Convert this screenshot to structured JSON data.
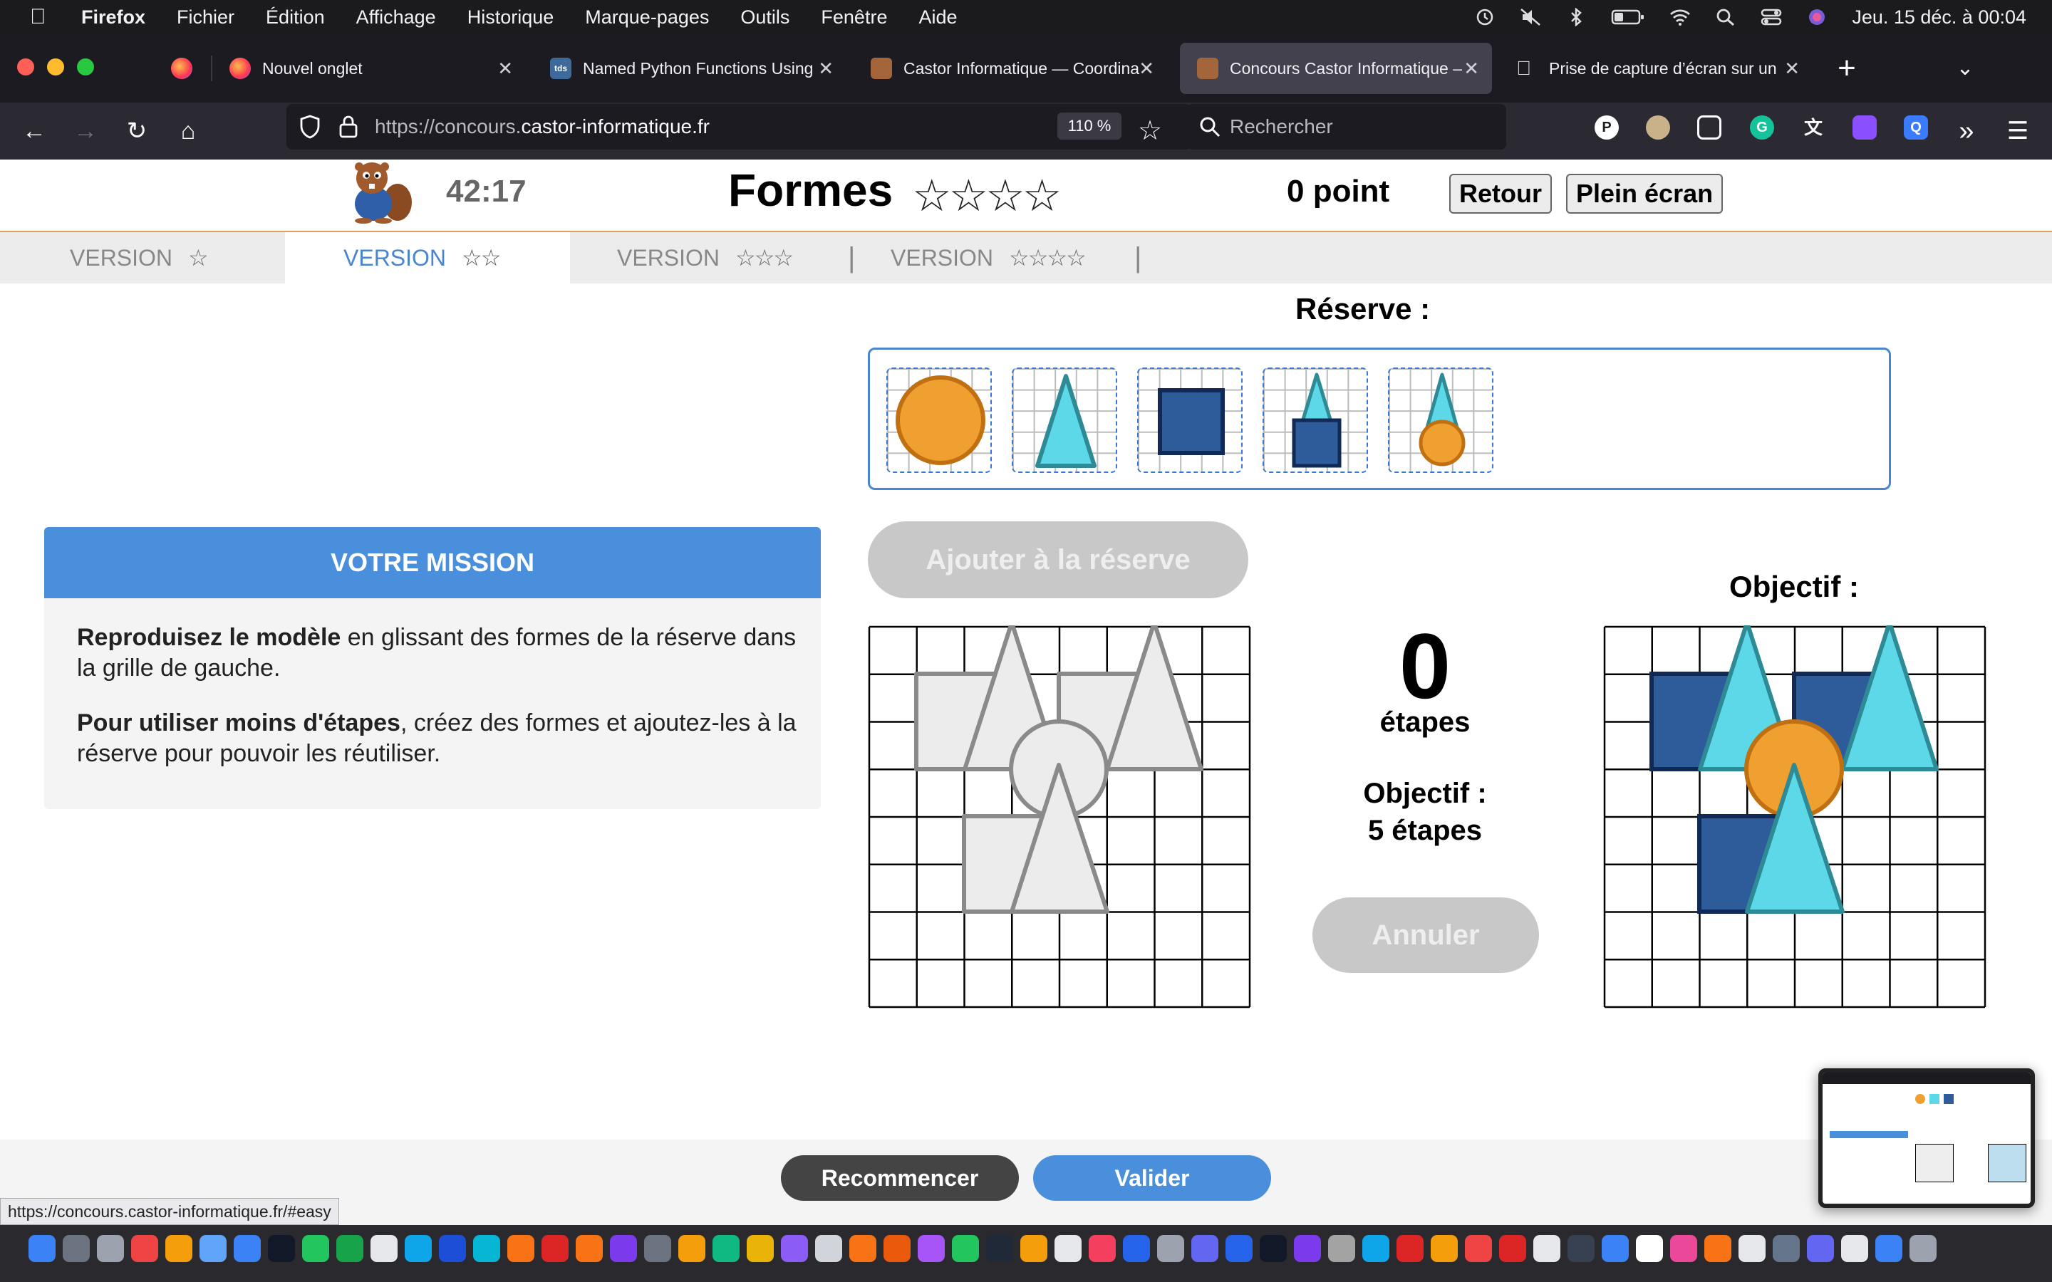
{
  "menubar": {
    "app": "Firefox",
    "items": [
      "Fichier",
      "Édition",
      "Affichage",
      "Historique",
      "Marque-pages",
      "Outils",
      "Fenêtre",
      "Aide"
    ],
    "clock": "Jeu. 15 déc. à  00:04"
  },
  "tabs": [
    {
      "title": "Nouvel onglet"
    },
    {
      "title": "Named Python Functions Using"
    },
    {
      "title": "Castor Informatique — Coordina"
    },
    {
      "title": "Concours Castor Informatique –"
    },
    {
      "title": "Prise de capture d’écran sur un"
    }
  ],
  "nav": {
    "url_prefix": "https://concours.",
    "url_domain": "castor-informatique.fr",
    "zoom": "110 %",
    "search_placeholder": "Rechercher"
  },
  "header": {
    "timer": "42:17",
    "title": "Formes",
    "title_stars": "☆☆☆☆",
    "points": "0 point",
    "back": "Retour",
    "fullscreen": "Plein écran"
  },
  "versions": [
    {
      "label": "VERSION",
      "stars": "☆"
    },
    {
      "label": "VERSION",
      "stars": "☆☆"
    },
    {
      "label": "VERSION",
      "stars": "☆☆☆"
    },
    {
      "label": "VERSION",
      "stars": "☆☆☆☆"
    }
  ],
  "version_sep": "|",
  "reserve_label": "Réserve :",
  "mission": {
    "heading": "VOTRE MISSION",
    "p1_bold": "Reproduisez le modèle",
    "p1_rest": " en glissant des formes de la réserve dans la grille de gauche.",
    "p2_bold": "Pour utiliser moins d'étapes",
    "p2_rest": ", créez des formes et ajoutez-les à la réserve pour pouvoir les réutiliser."
  },
  "controls": {
    "add_to_reserve": "Ajouter à la réserve",
    "steps_count": "0",
    "steps_label": "étapes",
    "objective_line1": "Objectif :",
    "objective_line2": "5 étapes",
    "undo": "Annuler"
  },
  "objective_label": "Objectif :",
  "footer": {
    "restart": "Recommencer",
    "validate": "Valider",
    "status_url": "https://concours.castor-informatique.fr/#easy"
  },
  "colors": {
    "orange": "#f0a030",
    "cyan": "#5cd8e8",
    "navy": "#2e5b9a",
    "accent_blue": "#4a8fdc"
  }
}
